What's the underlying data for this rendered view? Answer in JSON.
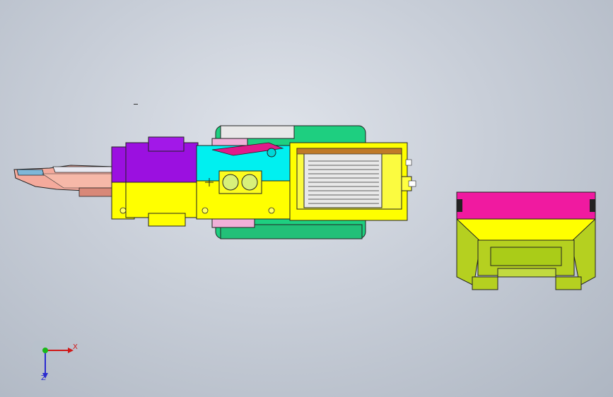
{
  "viewport": {
    "colors": {
      "background": "#c8ced8",
      "purple": "#9b10e0",
      "yellow": "#ffff00",
      "cyan": "#00f0f0",
      "magenta": "#f01aa0",
      "green": "#1ecf80",
      "olive": "#b5d020",
      "salmon": "#f2a090"
    }
  },
  "triad": {
    "x_label": "X",
    "z_label": "Z",
    "icon": "coordinate-triad-icon"
  }
}
